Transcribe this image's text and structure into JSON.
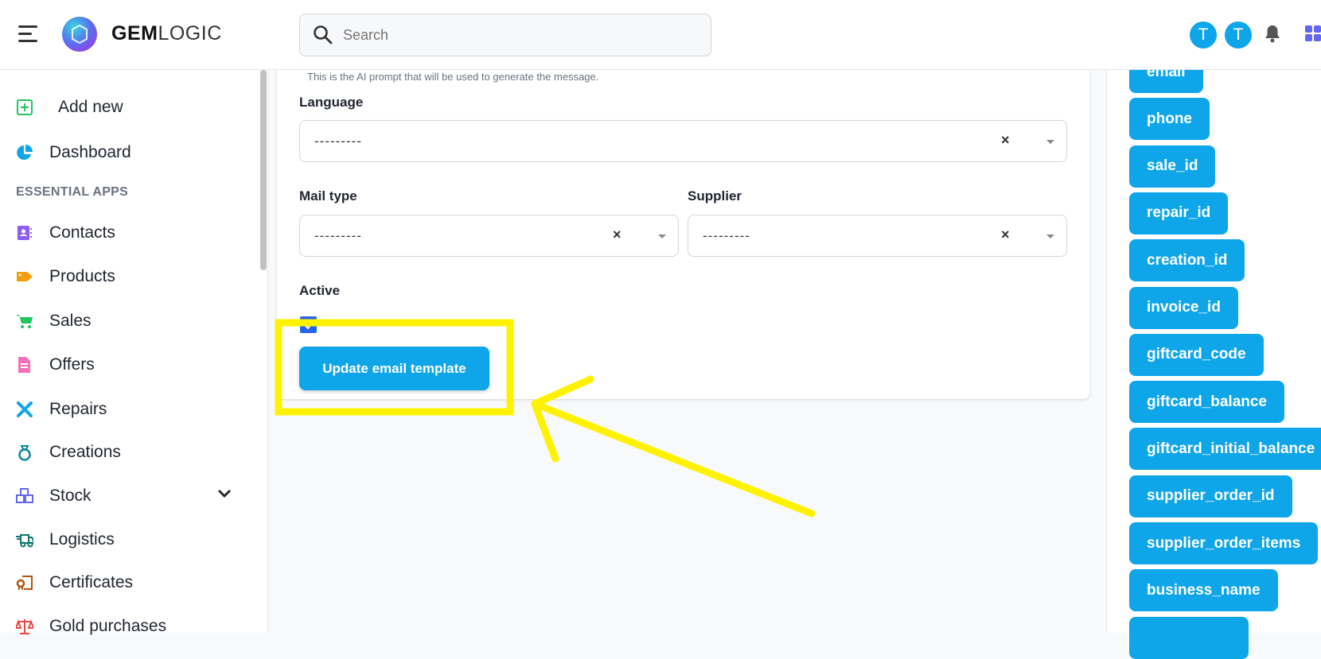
{
  "header": {
    "brand_bold": "GEM",
    "brand_light": "LOGIC",
    "search_placeholder": "Search",
    "avatars": [
      "T",
      "T"
    ]
  },
  "sidebar": {
    "add_new": "Add new",
    "dashboard": "Dashboard",
    "section": "ESSENTIAL APPS",
    "items": [
      {
        "label": "Contacts",
        "icon": "contacts-icon",
        "color": "#8b5cf6"
      },
      {
        "label": "Products",
        "icon": "tag-icon",
        "color": "#f59e0b"
      },
      {
        "label": "Sales",
        "icon": "cart-icon",
        "color": "#22c55e"
      },
      {
        "label": "Offers",
        "icon": "document-icon",
        "color": "#f472b6"
      },
      {
        "label": "Repairs",
        "icon": "tools-icon",
        "color": "#0ea5e9"
      },
      {
        "label": "Creations",
        "icon": "ring-icon",
        "color": "#0e8a9a"
      },
      {
        "label": "Stock",
        "icon": "boxes-icon",
        "color": "#6366f1"
      },
      {
        "label": "Logistics",
        "icon": "truck-icon",
        "color": "#0f766e"
      },
      {
        "label": "Certificates",
        "icon": "certificate-icon",
        "color": "#b45309"
      },
      {
        "label": "Gold purchases",
        "icon": "scale-icon",
        "color": "#ef4444"
      }
    ]
  },
  "form": {
    "help_text": "This is the AI prompt that will be used to generate the message.",
    "language_label": "Language",
    "language_value": "---------",
    "mail_type_label": "Mail type",
    "mail_type_value": "---------",
    "supplier_label": "Supplier",
    "supplier_value": "---------",
    "clear_symbol": "×",
    "active_label": "Active",
    "active_checked": true,
    "submit_label": "Update email template"
  },
  "variables": [
    "email",
    "phone",
    "sale_id",
    "repair_id",
    "creation_id",
    "invoice_id",
    "giftcard_code",
    "giftcard_balance",
    "giftcard_initial_balance",
    "supplier_order_id",
    "supplier_order_items",
    "business_name",
    ""
  ],
  "colors": {
    "accent": "#0ea5e9",
    "highlight": "#fff200"
  }
}
